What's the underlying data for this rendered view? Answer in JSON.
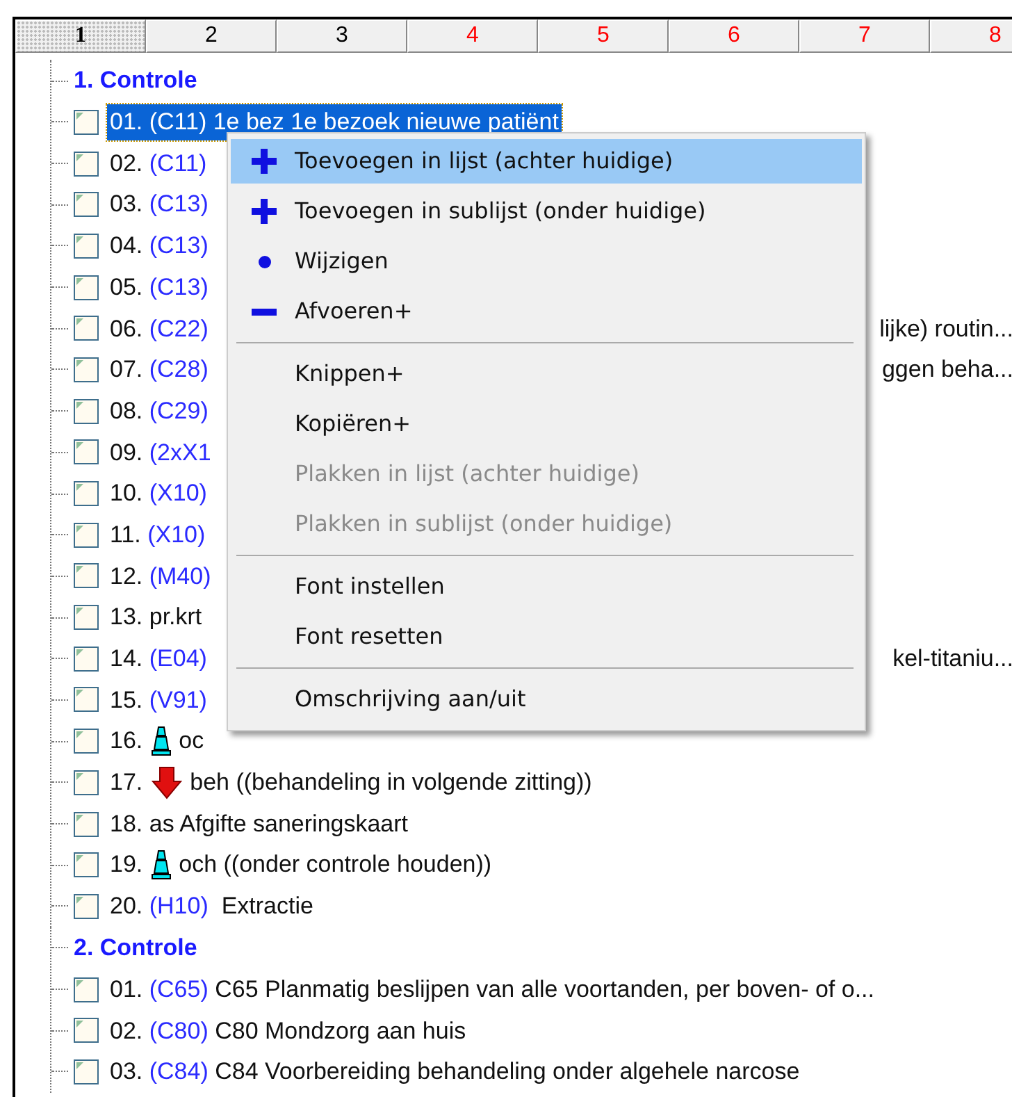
{
  "tabs": [
    {
      "label": "1",
      "selected": true,
      "color": "#000000"
    },
    {
      "label": "2",
      "selected": false,
      "color": "#000000"
    },
    {
      "label": "3",
      "selected": false,
      "color": "#000000"
    },
    {
      "label": "4",
      "selected": false,
      "color": "#ff0000"
    },
    {
      "label": "5",
      "selected": false,
      "color": "#ff0000"
    },
    {
      "label": "6",
      "selected": false,
      "color": "#ff0000"
    },
    {
      "label": "7",
      "selected": false,
      "color": "#ff0000"
    },
    {
      "label": "8",
      "selected": false,
      "color": "#ff0000"
    }
  ],
  "tree": [
    {
      "label": "1. Controle",
      "children": [
        {
          "number": "01.",
          "code": "(C11)",
          "text": "1e bez 1e bezoek nieuwe patiënt",
          "selected": true,
          "checked": false
        },
        {
          "number": "02.",
          "code": "(C11)",
          "selected": false,
          "checked": false
        },
        {
          "number": "03.",
          "code": "(C13)",
          "selected": false,
          "checked": false
        },
        {
          "number": "04.",
          "code": "(C13)",
          "selected": false,
          "checked": false
        },
        {
          "number": "05.",
          "code": "(C13)",
          "selected": false,
          "checked": false
        },
        {
          "number": "06.",
          "code": "(C22)",
          "tail": "lijke) routin...",
          "selected": false,
          "checked": false
        },
        {
          "number": "07.",
          "code": "(C28)",
          "tail": "ggen beha...",
          "selected": false,
          "checked": false
        },
        {
          "number": "08.",
          "code": "(C29)",
          "selected": false,
          "checked": false
        },
        {
          "number": "09.",
          "code": "(2xX1",
          "selected": false,
          "checked": false
        },
        {
          "number": "10.",
          "code": "(X10)",
          "selected": false,
          "checked": false
        },
        {
          "number": "11.",
          "code": "(X10)",
          "selected": false,
          "checked": false
        },
        {
          "number": "12.",
          "code": "(M40)",
          "selected": false,
          "checked": false
        },
        {
          "number": "13.",
          "text": "pr.krt",
          "selected": false,
          "checked": false
        },
        {
          "number": "14.",
          "code": "(E04)",
          "tail": "kel-titaniu...",
          "selected": false,
          "checked": false
        },
        {
          "number": "15.",
          "code": "(V91)",
          "selected": false,
          "checked": false
        },
        {
          "number": "16.",
          "kind": "cone",
          "text": "oc",
          "selected": false,
          "checked": false
        },
        {
          "number": "17.",
          "kind": "arrow",
          "text": "beh ((behandeling in volgende zitting))",
          "selected": false,
          "checked": false
        },
        {
          "number": "18.",
          "text": "as Afgifte saneringskaart",
          "selected": false,
          "checked": false
        },
        {
          "number": "19.",
          "kind": "cone",
          "text": "och ((onder controle houden))",
          "selected": false,
          "checked": false
        },
        {
          "number": "20.",
          "code": "(H10)",
          "text": " Extractie",
          "selected": false,
          "checked": false
        }
      ]
    },
    {
      "label": "2. Controle",
      "children": [
        {
          "number": "01.",
          "code": "(C65)",
          "text": "C65 Planmatig beslijpen van alle voortanden, per boven- of o...",
          "selected": false,
          "checked": false
        },
        {
          "number": "02.",
          "code": "(C80)",
          "text": "C80 Mondzorg aan huis",
          "selected": false,
          "checked": false
        },
        {
          "number": "03.",
          "code": "(C84)",
          "text": "C84 Voorbereiding behandeling onder algehele narcose",
          "selected": false,
          "checked": false
        }
      ]
    }
  ],
  "context_menu": [
    {
      "kind": "add",
      "label": "Toevoegen in lijst (achter huidige)",
      "selected": true,
      "disabled": false
    },
    {
      "kind": "add",
      "label": "Toevoegen in sublijst (onder huidige)",
      "selected": false,
      "disabled": false
    },
    {
      "kind": "edit",
      "label": "Wijzigen",
      "selected": false,
      "disabled": false
    },
    {
      "kind": "remove",
      "label": "Afvoeren+",
      "selected": false,
      "disabled": false
    },
    {
      "kind": "separator"
    },
    {
      "kind": "item",
      "label": "Knippen+",
      "selected": false,
      "disabled": false
    },
    {
      "kind": "item",
      "label": "Kopiëren+",
      "selected": false,
      "disabled": false
    },
    {
      "kind": "item",
      "label": "Plakken in lijst (achter huidige)",
      "selected": false,
      "disabled": true
    },
    {
      "kind": "item",
      "label": "Plakken in sublijst (onder huidige)",
      "selected": false,
      "disabled": true
    },
    {
      "kind": "separator"
    },
    {
      "kind": "item",
      "label": "Font instellen",
      "selected": false,
      "disabled": false
    },
    {
      "kind": "item",
      "label": "Font resetten",
      "selected": false,
      "disabled": false
    },
    {
      "kind": "separator"
    },
    {
      "kind": "item",
      "label": "Omschrijving aan/uit",
      "selected": false,
      "disabled": false
    }
  ]
}
